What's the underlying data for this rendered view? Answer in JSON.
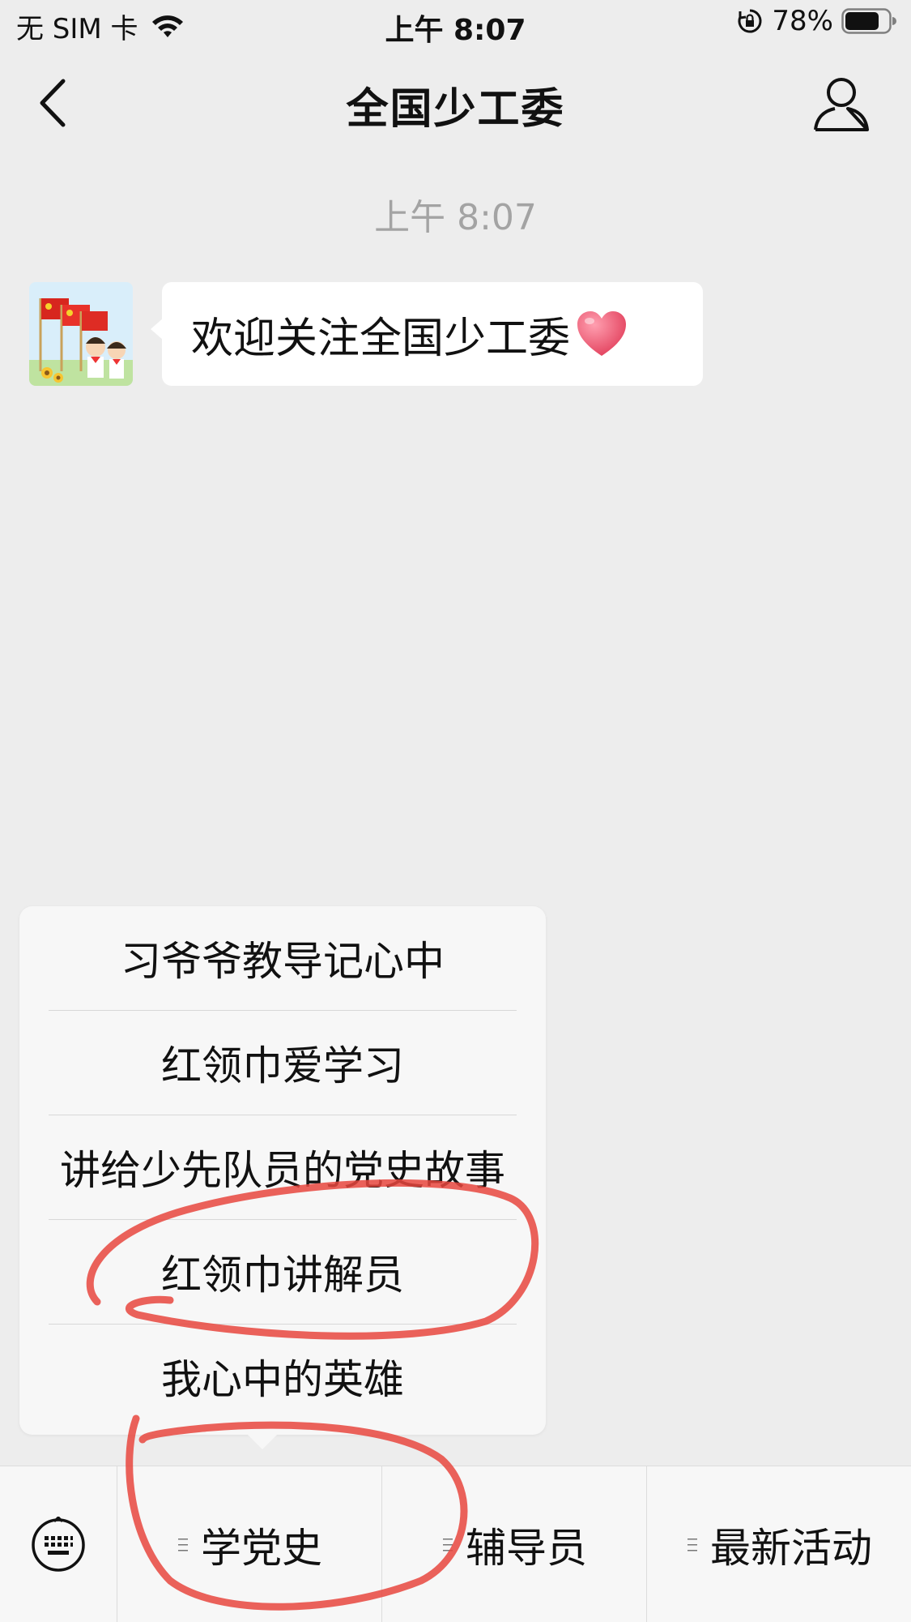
{
  "status_bar": {
    "carrier": "无 SIM 卡",
    "time": "上午 8:07",
    "battery_percent": "78%",
    "battery_level": 0.78,
    "icons": [
      "wifi-icon",
      "rotation-lock-icon",
      "battery-icon"
    ]
  },
  "nav": {
    "title": "全国少工委",
    "back_icon": "chevron-left-icon",
    "profile_icon": "person-icon"
  },
  "chat": {
    "timestamp": "上午 8:07",
    "messages": [
      {
        "sender": "全国少工委",
        "avatar_icon": "avatar-flags-children-image",
        "text": "欢迎关注全国少工委",
        "emoji": "heart-icon"
      }
    ]
  },
  "submenu": {
    "items": [
      {
        "label": "习爷爷教导记心中"
      },
      {
        "label": "红领巾爱学习"
      },
      {
        "label": "讲给少先队员的党史故事"
      },
      {
        "label": "红领巾讲解员"
      },
      {
        "label": "我心中的英雄"
      }
    ]
  },
  "bottom_menu": {
    "keyboard_icon": "keyboard-icon",
    "tabs": [
      {
        "label": "学党史",
        "icon": "menu-lines-icon"
      },
      {
        "label": "辅导员",
        "icon": "menu-lines-icon"
      },
      {
        "label": "最新活动",
        "icon": "menu-lines-icon"
      }
    ]
  },
  "colors": {
    "background": "#ededed",
    "bubble": "#ffffff",
    "menu_background": "#f7f7f7",
    "annotation_red": "#e8463e",
    "heart": "#e8516a"
  }
}
